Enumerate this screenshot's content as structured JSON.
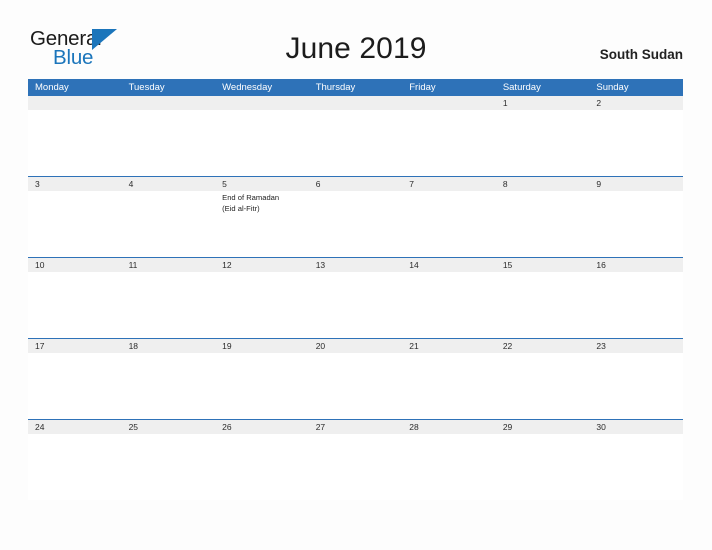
{
  "brand": {
    "name_part1": "General",
    "name_part2": "Blue",
    "accent_color": "#1b75bb"
  },
  "header": {
    "title": "June 2019",
    "region": "South Sudan"
  },
  "calendar": {
    "header_bg_color": "#2e72b8",
    "date_band_color": "#efefef",
    "weekdays": [
      "Monday",
      "Tuesday",
      "Wednesday",
      "Thursday",
      "Friday",
      "Saturday",
      "Sunday"
    ],
    "weeks": [
      {
        "days": [
          {
            "date": "",
            "events": []
          },
          {
            "date": "",
            "events": []
          },
          {
            "date": "",
            "events": []
          },
          {
            "date": "",
            "events": []
          },
          {
            "date": "",
            "events": []
          },
          {
            "date": "1",
            "events": []
          },
          {
            "date": "2",
            "events": []
          }
        ]
      },
      {
        "days": [
          {
            "date": "3",
            "events": []
          },
          {
            "date": "4",
            "events": []
          },
          {
            "date": "5",
            "events": [
              "End of Ramadan",
              "(Eid al-Fitr)"
            ]
          },
          {
            "date": "6",
            "events": []
          },
          {
            "date": "7",
            "events": []
          },
          {
            "date": "8",
            "events": []
          },
          {
            "date": "9",
            "events": []
          }
        ]
      },
      {
        "days": [
          {
            "date": "10",
            "events": []
          },
          {
            "date": "11",
            "events": []
          },
          {
            "date": "12",
            "events": []
          },
          {
            "date": "13",
            "events": []
          },
          {
            "date": "14",
            "events": []
          },
          {
            "date": "15",
            "events": []
          },
          {
            "date": "16",
            "events": []
          }
        ]
      },
      {
        "days": [
          {
            "date": "17",
            "events": []
          },
          {
            "date": "18",
            "events": []
          },
          {
            "date": "19",
            "events": []
          },
          {
            "date": "20",
            "events": []
          },
          {
            "date": "21",
            "events": []
          },
          {
            "date": "22",
            "events": []
          },
          {
            "date": "23",
            "events": []
          }
        ]
      },
      {
        "days": [
          {
            "date": "24",
            "events": []
          },
          {
            "date": "25",
            "events": []
          },
          {
            "date": "26",
            "events": []
          },
          {
            "date": "27",
            "events": []
          },
          {
            "date": "28",
            "events": []
          },
          {
            "date": "29",
            "events": []
          },
          {
            "date": "30",
            "events": []
          }
        ]
      }
    ]
  }
}
